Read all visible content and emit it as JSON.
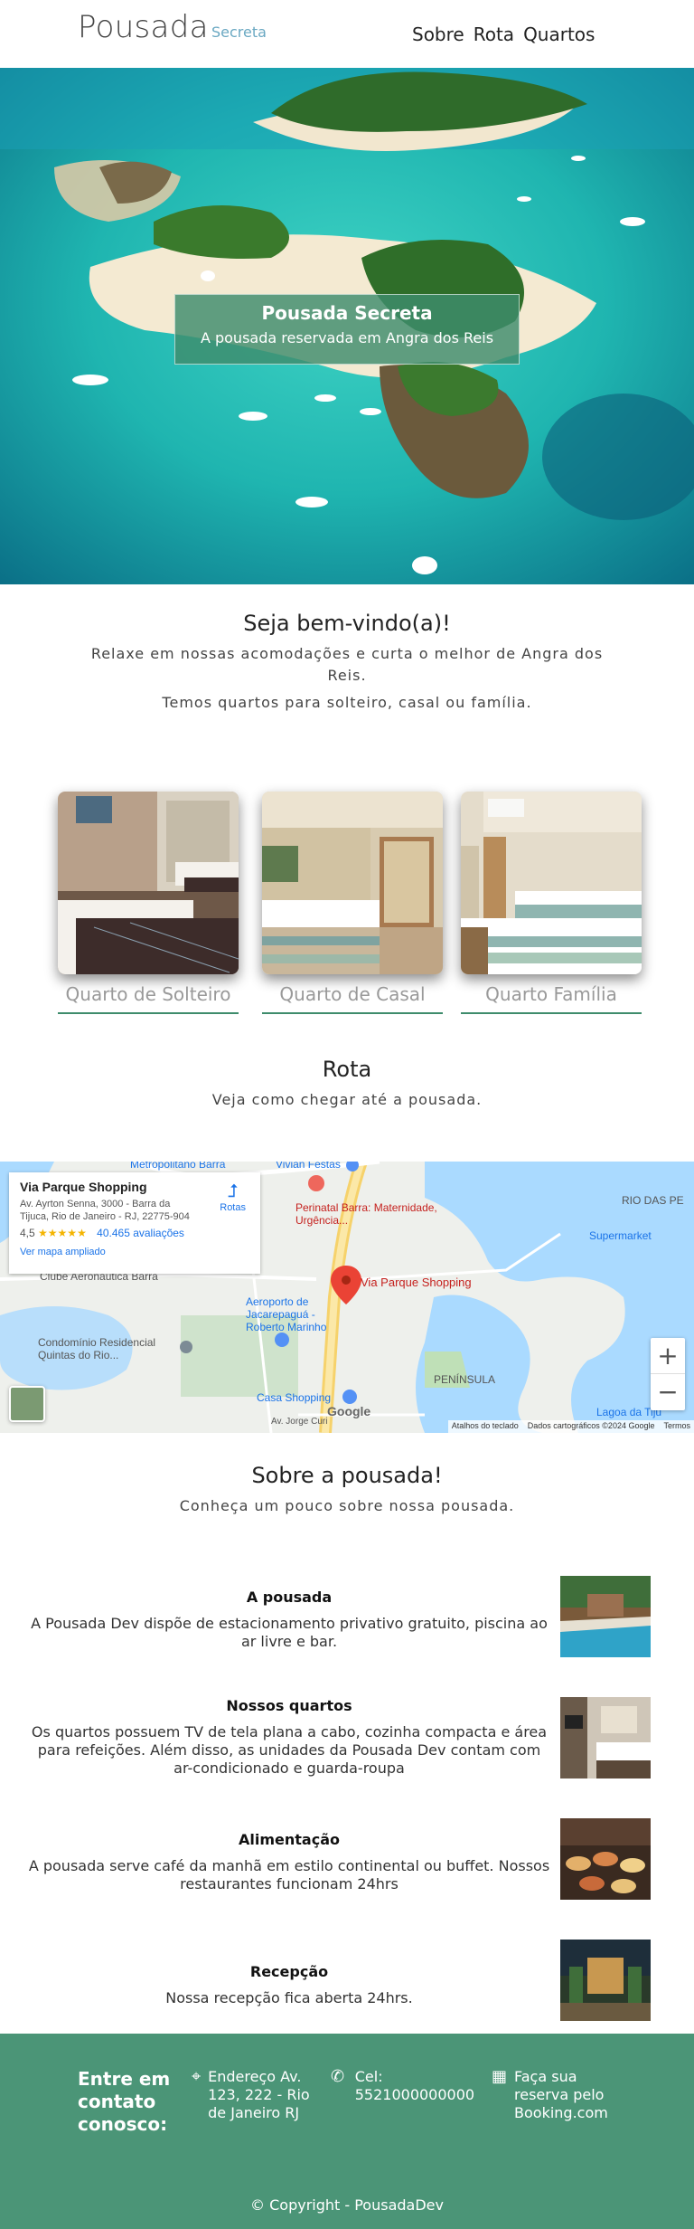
{
  "header": {
    "brand": "Pousada",
    "brand_sub": "Secreta",
    "nav": [
      "Sobre",
      "Rota",
      "Quartos"
    ]
  },
  "hero": {
    "title": "Pousada Secreta",
    "subtitle": "A pousada reservada em Angra dos Reis"
  },
  "welcome": {
    "title": "Seja bem-vindo(a)!",
    "p1": "Relaxe em nossas acomodações e curta o melhor de Angra dos Reis.",
    "p2": "Temos quartos para solteiro, casal ou família."
  },
  "rooms": [
    {
      "label": "Quarto de Solteiro"
    },
    {
      "label": "Quarto de Casal"
    },
    {
      "label": "Quarto Família"
    }
  ],
  "route": {
    "title": "Rota",
    "subtitle": "Veja como chegar até a pousada."
  },
  "map": {
    "place_name": "Via Parque Shopping",
    "address": "Av. Ayrton Senna, 3000 - Barra da Tijuca, Rio de Janeiro - RJ, 22775-904",
    "rating": "4,5",
    "stars": "★★★★★",
    "reviews": "40.465 avaliações",
    "expand_link": "Ver mapa ampliado",
    "route_label": "Rotas",
    "pin_label": "Via Parque Shopping",
    "zoom_in": "+",
    "zoom_out": "−",
    "footer_keys": "Atalhos do teclado",
    "footer_data": "Dados cartográficos ©2024 Google",
    "footer_terms": "Termos",
    "logo": "Google",
    "labels": {
      "metropolitano": "Metropolitano Barra",
      "vivian": "Vivian Festas",
      "perinatal": "Perinatal Barra: Maternidade, Urgência...",
      "rio_das_pedras": "RIO DAS PE",
      "supermarket": "Supermarket",
      "clube": "Clube Aeronáutica Barra",
      "aeroporto": "Aeroporto de Jacarepaguá - Roberto Marinho",
      "condominio": "Condomínio Residencial Quintas do Rio...",
      "peninsula": "PENÍNSULA",
      "casa_shopping": "Casa Shopping",
      "av_ayrton": "Av. Ayrton Senna",
      "jorge_curi": "Av. Jorge Curi",
      "lagoa": "Lagoa da Tiju"
    }
  },
  "about": {
    "title": "Sobre a pousada!",
    "subtitle": "Conheça um pouco sobre nossa pousada.",
    "features": [
      {
        "title": "A pousada",
        "desc": "A Pousada Dev dispõe de estacionamento privativo gratuito, piscina ao ar livre e bar."
      },
      {
        "title": "Nossos quartos",
        "desc": "Os quartos possuem TV de tela plana a cabo, cozinha compacta e área para refeições. Além disso, as unidades da Pousada Dev contam com ar-condicionado e guarda-roupa"
      },
      {
        "title": "Alimentação",
        "desc": "A pousada serve café da manhã em estilo continental ou buffet. Nossos restaurantes funcionam 24hrs"
      },
      {
        "title": "Recepção",
        "desc": "Nossa recepção fica aberta 24hrs."
      }
    ]
  },
  "footer": {
    "contact": "Entre em contato conosco:",
    "address": "Endereço Av. 123, 222 - Rio de Janeiro RJ",
    "phone": "Cel: 5521000000000",
    "booking": "Faça sua reserva pelo Booking.com",
    "copyright": "© Copyright - PousadaDev"
  }
}
